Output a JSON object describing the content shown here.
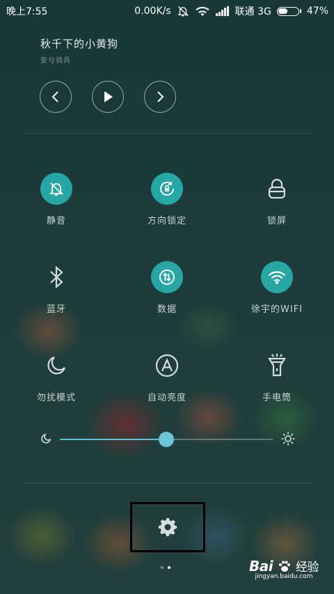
{
  "status_bar": {
    "time": "晚上7:55",
    "speed": "0.00K/s",
    "carrier": "联通 3G",
    "battery_percent": "47%",
    "battery_level": 0.47
  },
  "music": {
    "title": "秋千下的小黄狗",
    "artist": "安与骑兵",
    "prev_icon": "chevron-left-icon",
    "play_icon": "play-icon",
    "next_icon": "chevron-right-icon"
  },
  "toggles": [
    {
      "label": "静音",
      "icon": "bell-off-icon",
      "active": true
    },
    {
      "label": "方向锁定",
      "icon": "rotation-lock-icon",
      "active": true
    },
    {
      "label": "锁屏",
      "icon": "lock-icon",
      "active": false
    },
    {
      "label": "蓝牙",
      "icon": "bluetooth-icon",
      "active": false
    },
    {
      "label": "数据",
      "icon": "mobile-data-icon",
      "active": true
    },
    {
      "label": "徐宇的WIFI",
      "icon": "wifi-icon",
      "active": true
    },
    {
      "label": "勿扰模式",
      "icon": "moon-icon",
      "active": false
    },
    {
      "label": "自动亮度",
      "icon": "auto-brightness-icon",
      "active": false
    },
    {
      "label": "手电筒",
      "icon": "flashlight-icon",
      "active": false
    }
  ],
  "brightness": {
    "level": 0.5
  },
  "settings_icon": "gear-icon",
  "page_indicator": {
    "pages": 2,
    "current": 2
  },
  "colors": {
    "accent": "#27a6a6",
    "slider": "#5ec2d2"
  },
  "watermark": {
    "brand_latin": "Bai",
    "brand_cn": "经验",
    "url": "jingyan.baidu.com"
  }
}
